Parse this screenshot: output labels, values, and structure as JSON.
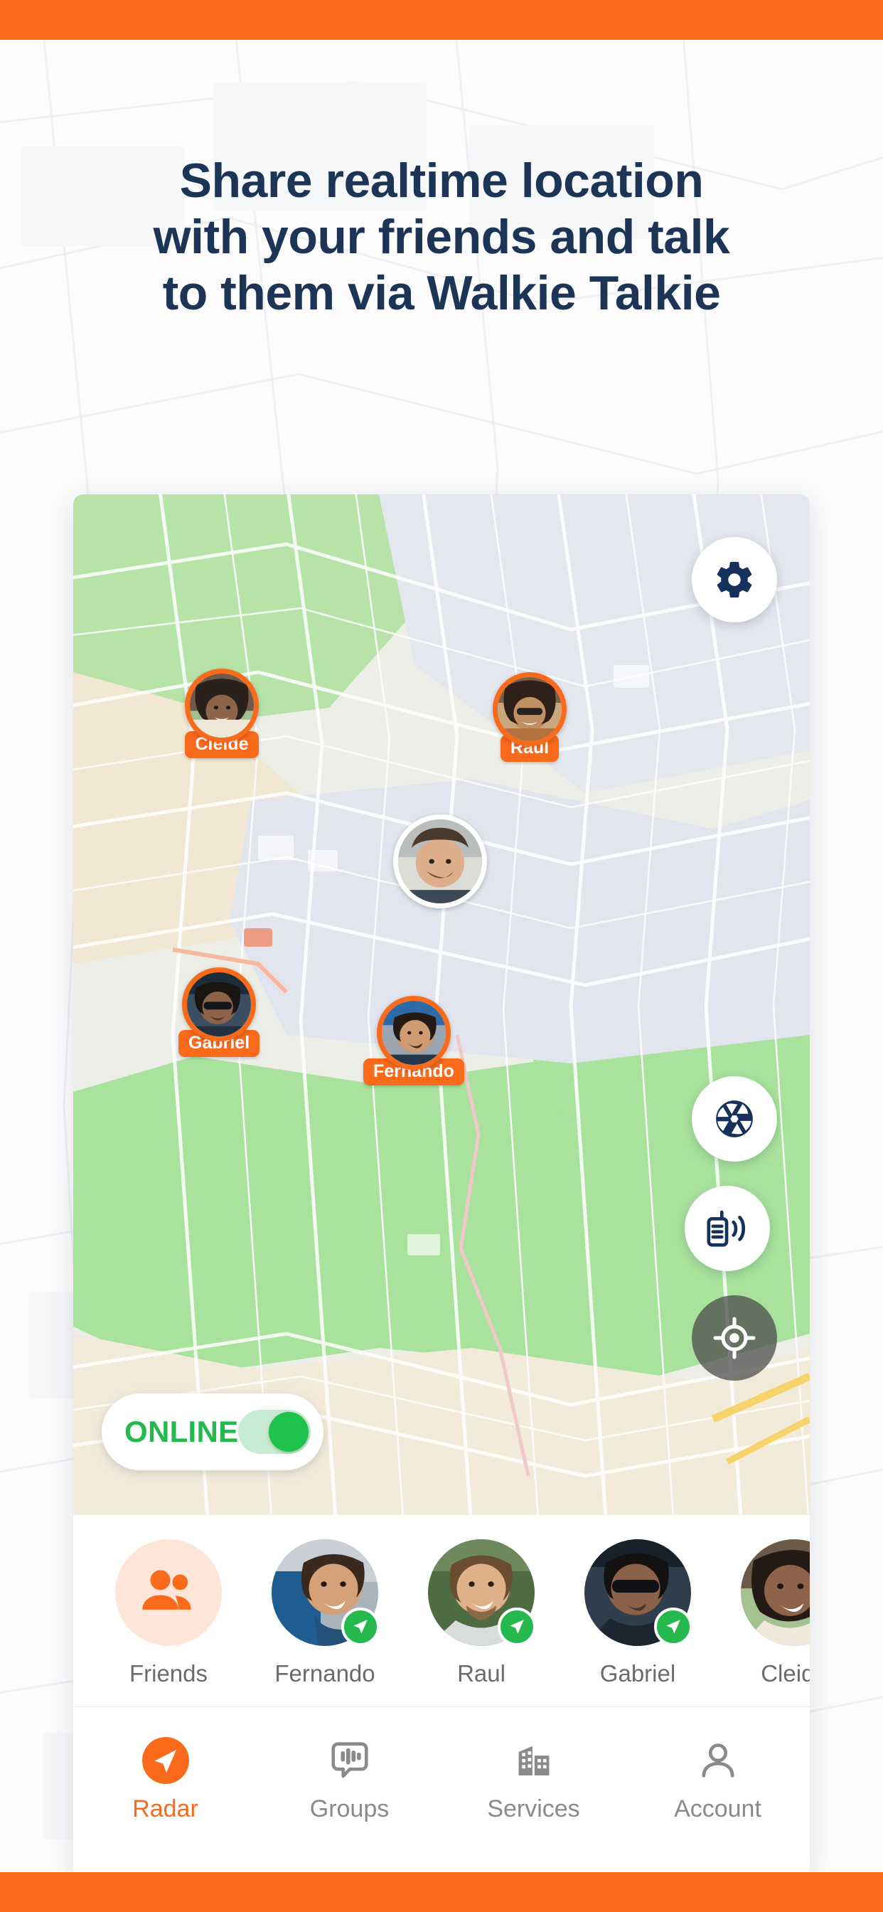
{
  "theme": {
    "brand_orange": "#F96A1B",
    "headline_navy": "#1C3557",
    "online_green": "#25B84C",
    "badge_green": "#25B84C",
    "muted_gray": "#8a8a8a"
  },
  "headline": {
    "line1": "Share realtime location",
    "line2": "with your friends and talk",
    "line3": "to them via Walkie Talkie"
  },
  "map": {
    "buttons": [
      {
        "name": "settings",
        "icon": "gear-icon"
      },
      {
        "name": "camera",
        "icon": "aperture-icon"
      },
      {
        "name": "walkie-talkie",
        "icon": "walkie-talkie-icon"
      },
      {
        "name": "locate",
        "icon": "crosshair-icon"
      }
    ],
    "markers": [
      {
        "name": "Cleide",
        "is_self": false
      },
      {
        "name": "Raul",
        "is_self": false
      },
      {
        "name": "",
        "is_self": true
      },
      {
        "name": "Gabriel",
        "is_self": false
      },
      {
        "name": "Fernando",
        "is_self": false
      }
    ],
    "status_toggle": {
      "label": "ONLINE",
      "state": "on"
    }
  },
  "friends_strip": {
    "items": [
      {
        "label": "Friends",
        "type": "group",
        "online": false
      },
      {
        "label": "Fernando",
        "type": "person",
        "online": true
      },
      {
        "label": "Raul",
        "type": "person",
        "online": true
      },
      {
        "label": "Gabriel",
        "type": "person",
        "online": true
      },
      {
        "label": "Cleide",
        "type": "person",
        "online": true
      }
    ]
  },
  "tabbar": {
    "tabs": [
      {
        "label": "Radar",
        "icon": "navigation-arrow-icon",
        "active": true
      },
      {
        "label": "Groups",
        "icon": "voice-bubble-icon",
        "active": false
      },
      {
        "label": "Services",
        "icon": "buildings-icon",
        "active": false
      },
      {
        "label": "Account",
        "icon": "person-icon",
        "active": false
      }
    ]
  }
}
